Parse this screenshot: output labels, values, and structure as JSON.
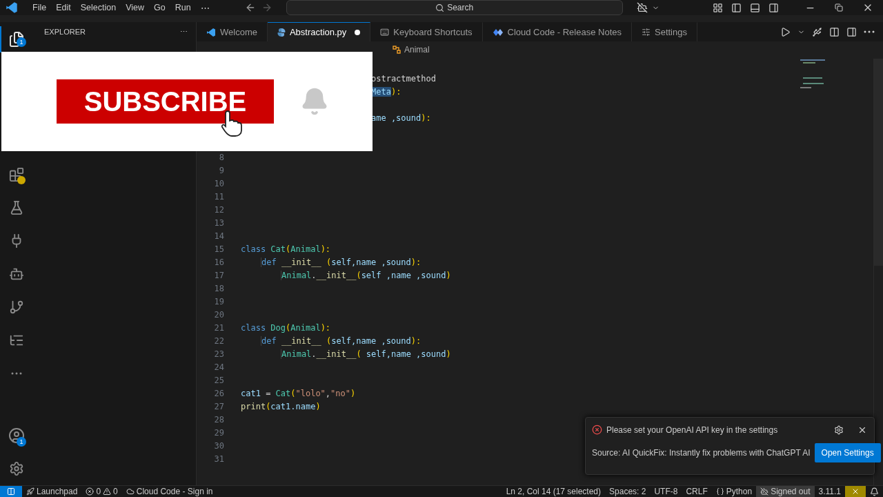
{
  "title_bar": {
    "menus": [
      "File",
      "Edit",
      "Selection",
      "View",
      "Go",
      "Run",
      "⋯"
    ],
    "search": {
      "placeholder": "Search"
    }
  },
  "activity_bar": {
    "items": [
      {
        "kind": "files",
        "selected": true,
        "badge": "1"
      },
      {
        "kind": "extensions",
        "selected": false
      },
      {
        "kind": "testing",
        "selected": false
      },
      {
        "kind": "python",
        "selected": false
      },
      {
        "kind": "remote",
        "selected": false
      },
      {
        "kind": "git",
        "selected": false
      },
      {
        "kind": "outline",
        "selected": false
      },
      {
        "kind": "more",
        "selected": false
      }
    ],
    "bottom": [
      {
        "kind": "account",
        "badge": "1"
      },
      {
        "kind": "settings"
      }
    ]
  },
  "sidebar": {
    "title": "EXPLORER",
    "more": "⋯"
  },
  "tabs": [
    {
      "label": "Welcome",
      "kind": "welcome",
      "selected": false,
      "dirty": false
    },
    {
      "label": "Abstraction.py",
      "kind": "python",
      "selected": true,
      "dirty": true
    },
    {
      "label": "Keyboard Shortcuts",
      "kind": "keyboard",
      "selected": false,
      "dirty": false
    },
    {
      "label": "Cloud Code - Release Notes",
      "kind": "cloud",
      "selected": false,
      "dirty": false
    },
    {
      "label": "Settings",
      "kind": "settings",
      "selected": false,
      "dirty": false
    }
  ],
  "breadcrumb": {
    "symbol": "Animal"
  },
  "code": [
    {
      "kind": "covered"
    },
    {
      "kind": "partial",
      "tokens": [
        {
          "t": "ostractmethod",
          "kind": "plain"
        }
      ]
    },
    {
      "kind": "partial",
      "tokens": [
        {
          "t": "Meta",
          "kind": "selected"
        },
        {
          "t": "):",
          "kind": "paren"
        }
      ]
    },
    {
      "kind": "covered"
    },
    {
      "kind": "partial",
      "tokens": [
        {
          "t": "ame ,sound",
          "kind": "var"
        },
        {
          "t": "):",
          "kind": "paren"
        }
      ]
    },
    {
      "kind": "covered"
    },
    {
      "kind": "covered"
    },
    {
      "kind": "line",
      "n": "8"
    },
    {
      "kind": "line",
      "n": "9"
    },
    {
      "kind": "line",
      "n": "10"
    },
    {
      "kind": "line",
      "n": "11"
    },
    {
      "kind": "line",
      "n": "12"
    },
    {
      "kind": "line",
      "n": "13"
    },
    {
      "kind": "line",
      "n": "14"
    },
    {
      "kind": "line",
      "n": "15",
      "tokens": [
        {
          "t": "class ",
          "kind": "kw"
        },
        {
          "t": "Cat",
          "kind": "cls"
        },
        {
          "t": "(",
          "kind": "paren"
        },
        {
          "t": "Animal",
          "kind": "cls"
        },
        {
          "t": "):",
          "kind": "paren"
        }
      ],
      "children": [
        {
          "kind": "line",
          "n": "16",
          "tokens": [
            {
              "t": "def ",
              "kind": "kw"
            },
            {
              "t": "__init__ ",
              "kind": "fn"
            },
            {
              "t": "(",
              "kind": "paren"
            },
            {
              "t": "self,name ,sound",
              "kind": "var"
            },
            {
              "t": "):",
              "kind": "paren"
            }
          ],
          "children": [
            {
              "kind": "line",
              "n": "17",
              "tokens": [
                {
                  "t": "Animal",
                  "kind": "cls"
                },
                {
                  "t": ".",
                  "kind": "plain"
                },
                {
                  "t": "__init__",
                  "kind": "fn"
                },
                {
                  "t": "(",
                  "kind": "paren"
                },
                {
                  "t": "self ,name ,sound",
                  "kind": "var"
                },
                {
                  "t": ")",
                  "kind": "paren"
                }
              ]
            }
          ]
        }
      ]
    },
    {
      "kind": "line",
      "n": "18"
    },
    {
      "kind": "line",
      "n": "19"
    },
    {
      "kind": "line",
      "n": "20"
    },
    {
      "kind": "line",
      "n": "21",
      "tokens": [
        {
          "t": "class ",
          "kind": "kw"
        },
        {
          "t": "Dog",
          "kind": "cls"
        },
        {
          "t": "(",
          "kind": "paren"
        },
        {
          "t": "Animal",
          "kind": "cls"
        },
        {
          "t": "):",
          "kind": "paren"
        }
      ],
      "children": [
        {
          "kind": "line",
          "n": "22",
          "tokens": [
            {
              "t": "def ",
              "kind": "kw"
            },
            {
              "t": "__init__ ",
              "kind": "fn"
            },
            {
              "t": "(",
              "kind": "paren"
            },
            {
              "t": "self,name ,sound",
              "kind": "var"
            },
            {
              "t": "):",
              "kind": "paren"
            }
          ],
          "children": [
            {
              "kind": "line",
              "n": "23",
              "tokens": [
                {
                  "t": "Animal",
                  "kind": "cls"
                },
                {
                  "t": ".",
                  "kind": "plain"
                },
                {
                  "t": "__init__",
                  "kind": "fn"
                },
                {
                  "t": "( ",
                  "kind": "paren"
                },
                {
                  "t": "self,name ,sound",
                  "kind": "var"
                },
                {
                  "t": ")",
                  "kind": "paren"
                }
              ]
            }
          ]
        }
      ]
    },
    {
      "kind": "line",
      "n": "24"
    },
    {
      "kind": "line",
      "n": "25"
    },
    {
      "kind": "line",
      "n": "26",
      "tokens": [
        {
          "t": "cat1 ",
          "kind": "var"
        },
        {
          "t": "= ",
          "kind": "plain"
        },
        {
          "t": "Cat",
          "kind": "cls"
        },
        {
          "t": "(",
          "kind": "paren"
        },
        {
          "t": "\"lolo\"",
          "kind": "str"
        },
        {
          "t": ",",
          "kind": "plain"
        },
        {
          "t": "\"no\"",
          "kind": "str"
        },
        {
          "t": ")",
          "kind": "paren"
        }
      ]
    },
    {
      "kind": "line",
      "n": "27",
      "tokens": [
        {
          "t": "print",
          "kind": "fn"
        },
        {
          "t": "(",
          "kind": "paren"
        },
        {
          "t": "cat1.name",
          "kind": "var"
        },
        {
          "t": ")",
          "kind": "paren"
        }
      ]
    },
    {
      "kind": "line",
      "n": "28"
    },
    {
      "kind": "line",
      "n": "29"
    },
    {
      "kind": "line",
      "n": "30"
    },
    {
      "kind": "line",
      "n": "31"
    }
  ],
  "overlay": {
    "button": "SUBSCRIBE"
  },
  "notification": {
    "message": "Please set your OpenAI API key in the settings",
    "source": "Source: AI QuickFix: Instantly fix problems with ChatGPT AI",
    "action": "Open Settings"
  },
  "status_bar": {
    "left": [
      {
        "kind": "launchpad",
        "label": "Launchpad"
      },
      {
        "kind": "problems",
        "errors": "0",
        "warnings": "0"
      },
      {
        "kind": "cloud",
        "label": "Cloud Code - Sign in"
      }
    ],
    "right": [
      {
        "kind": "text",
        "label": "Ln 2, Col 14 (17 selected)"
      },
      {
        "kind": "text",
        "label": "Spaces: 2"
      },
      {
        "kind": "text",
        "label": "UTF-8"
      },
      {
        "kind": "text",
        "label": "CRLF"
      },
      {
        "kind": "language",
        "label": "Python"
      },
      {
        "kind": "account",
        "label": "Signed out"
      },
      {
        "kind": "text",
        "label": "3.11.1"
      }
    ]
  }
}
